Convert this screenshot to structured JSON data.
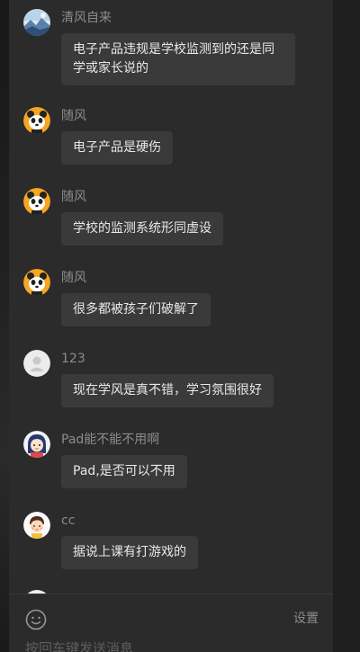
{
  "messages": [
    {
      "name": "清风自来",
      "avatar": "landscape-avatar",
      "text": "电子产品违规是学校监测到的还是同学或家长说的"
    },
    {
      "name": "随风",
      "avatar": "panda-avatar",
      "text": "电子产品是硬伤"
    },
    {
      "name": "随风",
      "avatar": "panda-avatar",
      "text": "学校的监测系统形同虚设"
    },
    {
      "name": "随风",
      "avatar": "panda-avatar",
      "text": "很多都被孩子们破解了"
    },
    {
      "name": "123",
      "avatar": "default-user-avatar",
      "text": "现在学风是真不错，学习氛围很好"
    },
    {
      "name": "Pad能不能不用啊",
      "avatar": "cartoon-girl-avatar",
      "text": "Pad,是否可以不用"
    },
    {
      "name": "cc",
      "avatar": "cartoon-kid-avatar",
      "text": "据说上课有打游戏的"
    }
  ],
  "footer": {
    "emoji_icon": "smiley-icon",
    "settings_label": "设置",
    "input_hint": "按回车键发送消息"
  },
  "colors": {
    "panel": "#2b2b2b",
    "bubble": "#3a3a3a",
    "name_text": "#8c8c8c",
    "bubble_text": "#e8e8e8",
    "panda_bg": "#f5a623"
  }
}
